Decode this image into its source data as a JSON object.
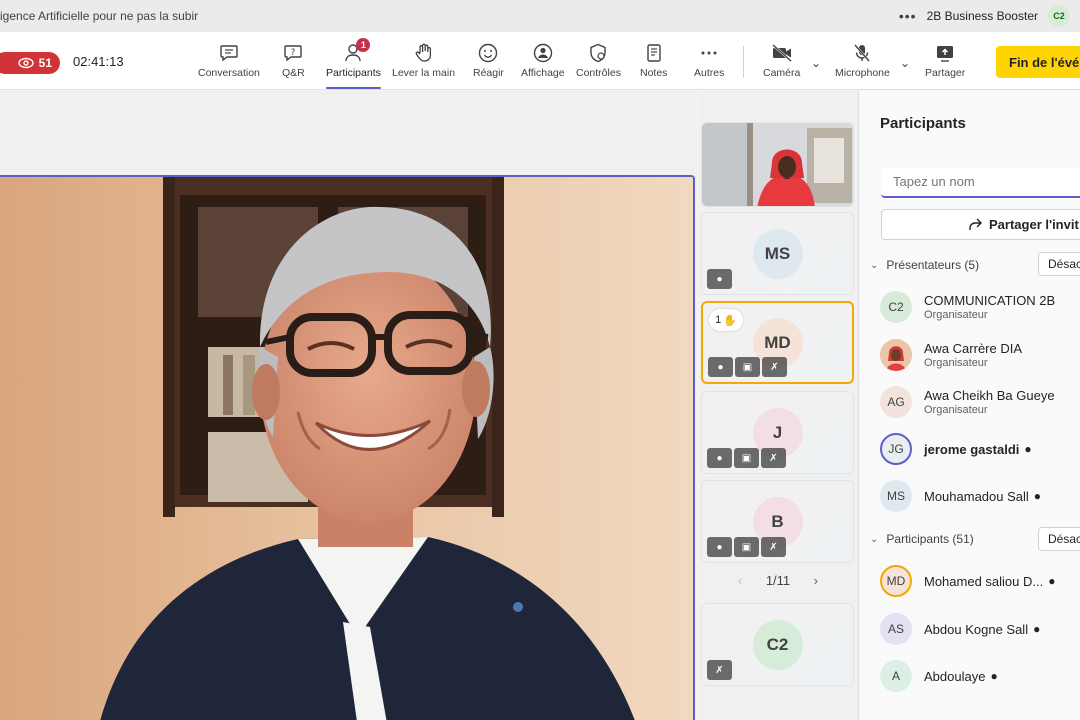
{
  "window": {
    "title": "igence Artificielle pour ne pas la subir",
    "more": "•••",
    "org": "2B Business Booster",
    "user_initials": "C2"
  },
  "toolbar": {
    "viewer_count": "51",
    "timer": "02:41:13",
    "participants_badge": "1",
    "buttons": {
      "conversation": "Conversation",
      "qa": "Q&R",
      "participants": "Participants",
      "raise_hand": "Lever la main",
      "react": "Réagir",
      "view": "Affichage",
      "controls": "Contrôles",
      "notes": "Notes",
      "more": "Autres",
      "camera": "Caméra",
      "microphone": "Microphone",
      "share": "Partager"
    },
    "end_button": "Fin de l'évé"
  },
  "thumbnails": [
    {
      "initials": "",
      "type": "video"
    },
    {
      "initials": "MS",
      "bg": "#dde8ef"
    },
    {
      "initials": "MD",
      "bg": "#f5e3d8",
      "hand": "1"
    },
    {
      "initials": "J",
      "bg": "#f3dde6"
    },
    {
      "initials": "B",
      "bg": "#f3dde6"
    },
    {
      "initials": "C2",
      "bg": "#d6ecd9"
    }
  ],
  "pager": {
    "label": "1/11"
  },
  "panel": {
    "title": "Participants",
    "search_placeholder": "Tapez un nom",
    "share_invite": "Partager l'invit",
    "presenters_label": "Présentateurs (5)",
    "participants_label": "Participants (51)",
    "mute_all": "Désac",
    "presenters": [
      {
        "initials": "C2",
        "name": "COMMUNICATION 2B",
        "role": "Organisateur",
        "bg": "#d6ecd9"
      },
      {
        "initials": "",
        "name": "Awa Carrère DIA",
        "role": "Organisateur",
        "bg": "#c99a7a"
      },
      {
        "initials": "AG",
        "name": "Awa Cheikh Ba Gueye",
        "role": "Organisateur",
        "bg": "#f3e3dc"
      },
      {
        "initials": "JG",
        "name": "jerome gastaldi",
        "role": "",
        "bg": "#e9eef0"
      },
      {
        "initials": "MS",
        "name": "Mouhamadou Sall",
        "role": "",
        "bg": "#dde8ef"
      }
    ],
    "attendees": [
      {
        "initials": "MD",
        "name": "Mohamed saliou D...",
        "bg": "#f5e3d8"
      },
      {
        "initials": "AS",
        "name": "Abdou Kogne Sall",
        "bg": "#e3e1f2"
      },
      {
        "initials": "A",
        "name": "Abdoulaye",
        "bg": "#dcefe5"
      }
    ]
  }
}
